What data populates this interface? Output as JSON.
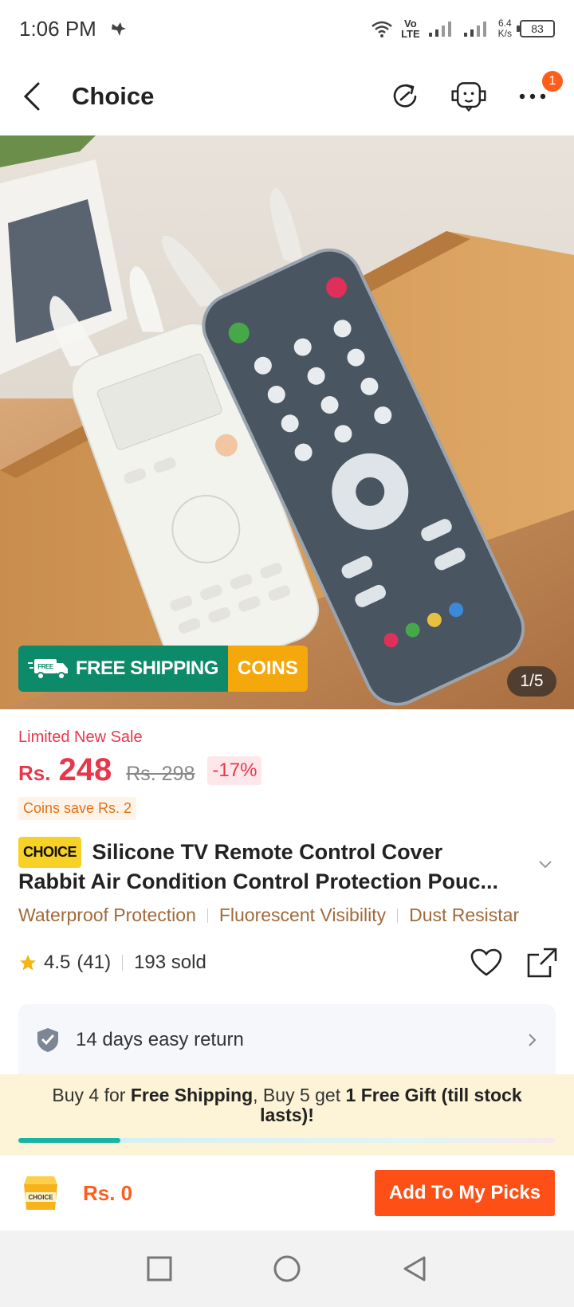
{
  "status_bar": {
    "time": "1:06 PM",
    "network_top": "Vo",
    "network_bottom": "LTE",
    "speed_value": "6.4",
    "speed_unit": "K/s",
    "battery": "83"
  },
  "header": {
    "title": "Choice",
    "cart_badge": "1"
  },
  "gallery": {
    "shipping_label": "FREE SHIPPING",
    "shipping_truck_text": "FREE",
    "coins_label": "COINS",
    "page_indicator": "1/5"
  },
  "price": {
    "sale_label": "Limited New Sale",
    "currency": "Rs.",
    "current": "248",
    "original": "Rs. 298",
    "discount": "-17%",
    "coins_save": "Coins save Rs. 2"
  },
  "product": {
    "choice_tag": "CHOICE",
    "title_line1": "Silicone TV Remote Control Cover",
    "title_line2": "Rabbit Air Condition Control Protection Pouc..."
  },
  "features": [
    "Waterproof Protection",
    "Fluorescent Visibility",
    "Dust Resistar"
  ],
  "rating": {
    "score": "4.5",
    "count": "(41)",
    "sold": "193 sold"
  },
  "return_policy": {
    "label": "14 days easy return"
  },
  "promo": {
    "part1": "Buy 4 for ",
    "bold1": "Free Shipping",
    "part2": ", Buy 5 get ",
    "bold2": "1 Free Gift (till stock lasts)!",
    "progress_fraction": 0.19
  },
  "bottom_bar": {
    "cart_box_text": "CHOICE",
    "total": "Rs. 0",
    "add_button": "Add To My Picks"
  },
  "colors": {
    "price_red": "#e8374d",
    "accent_orange": "#fd4f16",
    "shipping_green": "#0d8a6a",
    "coins_yellow": "#f4a80b",
    "feature_brown": "#a06a3a"
  }
}
